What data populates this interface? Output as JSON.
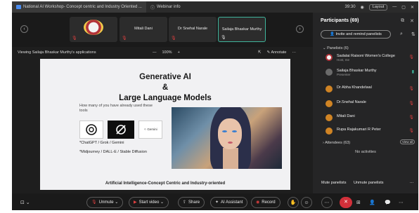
{
  "titlebar": {
    "tab1": "National AI Workshop- Concept centric and Industry Oriented ...",
    "tab2": "Webinar info",
    "time": "39:30",
    "layout": "Layout"
  },
  "thumbs": {
    "items": [
      {
        "name": "",
        "has_logo": true
      },
      {
        "name": "Mitali Dani"
      },
      {
        "name": "Dr Snehal Narale"
      },
      {
        "name": "Sailaja Bhaskar Murthy",
        "selected": true
      }
    ]
  },
  "viewbar": {
    "label": "Viewing Sailaja Bhaskar Murthy's applications",
    "zoom": "100%",
    "annotate": "Annotate"
  },
  "slide": {
    "title1": "Generative AI",
    "title2": "&",
    "title3": "Large Language Models",
    "question": "How many of you have already used these tools",
    "line1": "*ChatGPT / Grok / Gemini",
    "line2": "*Midjourney / DALL-E / Stable Diffusion",
    "footer": "Artificial Intelligence-Concept Centric and Industry-oriented",
    "logo3": "✧ Gemini"
  },
  "panel": {
    "title": "Participants (69)",
    "invite": "Invite and remind panelists",
    "panelists_header": "Panelists (6)",
    "panelists": [
      {
        "name": "Sadatai Raisoni Women's College",
        "sub": "Host, me"
      },
      {
        "name": "Sailaja Bhaskar Murthy",
        "sub": "Presenter"
      },
      {
        "name": "Dr Abha Khandelwal",
        "sub": ""
      },
      {
        "name": "Dr.Snehal Narale",
        "sub": ""
      },
      {
        "name": "Mitali Dani",
        "sub": ""
      },
      {
        "name": "Rupa Rajakumari R Peter",
        "sub": ""
      }
    ],
    "attendees_header": "Attendees (63)",
    "view_all": "View all",
    "no_activities": "No activities",
    "mute_panelists": "Mute panelists",
    "unmute_panelists": "Unmute panelists"
  },
  "toolbar": {
    "unmute": "Unmute",
    "start_video": "Start video",
    "share": "Share",
    "ai_assistant": "AI Assistant",
    "record": "Record"
  }
}
